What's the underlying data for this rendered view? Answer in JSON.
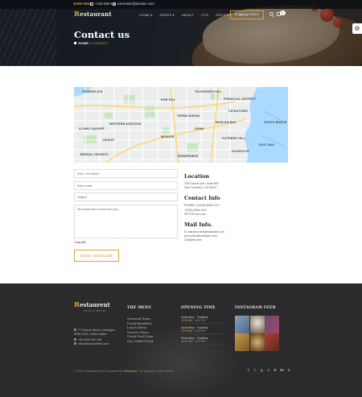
{
  "topbar": {
    "order_label": "Order Now!",
    "phone": "+123-205-445",
    "email": "username@domain.com"
  },
  "brand": {
    "name_initial": "R",
    "name_rest": "estaurant"
  },
  "nav": {
    "items": [
      {
        "label": "HOME",
        "caret": true
      },
      {
        "label": "PAGES",
        "caret": true
      },
      {
        "label": "ABOUT",
        "caret": false
      },
      {
        "label": "CTO",
        "caret": false
      },
      {
        "label": "RECIPES",
        "caret": false
      },
      {
        "label": "BLOG",
        "caret": false
      }
    ],
    "reserve_label": "BOOK A TABLE",
    "cart_count": "0"
  },
  "hero": {
    "title": "Contact us",
    "crumb_home": "HOME",
    "crumb_sep": "/",
    "crumb_current": "CONTACT"
  },
  "map": {
    "labels": [
      "TENDERLOIN",
      "TELEGRAPH HILL",
      "NOB HILL",
      "FINANCIAL DISTRICT",
      "CHINATOWN",
      "SOUTH BEACH",
      "YERBA BUENA",
      "POTRERO HILL",
      "MISSION BAY",
      "SOMA",
      "MISSION",
      "ALAMO SQUARE",
      "HAIGHT",
      "WESTERN ADDITION",
      "DOGPATCH",
      "BERNAL HEIGHTS",
      "TENDERNESS",
      "EAST BAY"
    ]
  },
  "form": {
    "name_placeholder": "Enter Your Name",
    "email_placeholder": "Enter email",
    "subject_placeholder": "Subject",
    "message_placeholder": "We would love to hear from you...",
    "captcha_label": "Cozy Mix",
    "send_label": "SEND MESSAGE"
  },
  "info": {
    "location_title": "Location",
    "location_lines": [
      "795 Folsom Ave, Suite 600",
      "San Francisco, CA 94107"
    ],
    "contact_title": "Contact Info",
    "contact_lines": [
      "PHONE:+(1234) 8546-XXX",
      "+(234) 8546-XXX",
      "SKYPE://un.cow"
    ],
    "mail_title": "Mail Info.",
    "mail_lines": [
      "E-mail:john.trek@example.com",
      "jhon.strek@example.com",
      "ToD@trit.dew"
    ]
  },
  "footer": {
    "logo_initial": "R",
    "logo_rest": "estaurent",
    "logo_sub": "FOOD & DRINK",
    "address_lines": [
      "77 Francis Street, Darlington",
      "NSW 2010, United States"
    ],
    "phone": "+00 0000 654 356",
    "email": "office@scboarbitoo.com",
    "menu_title": "THE MENU",
    "menu_items": [
      "Seasonal Items",
      "Fresh Breakfast",
      "Lunch Menu",
      "Dessert Menu",
      "Fresh Food Zone",
      "Our Grilled Food"
    ],
    "hours_title": "OPENING TIME",
    "hours": [
      {
        "day": "Saturday - Sunday",
        "time": "10:00 AM",
        "pm": "3:00 PM"
      },
      {
        "day": "Saturday - Sunday",
        "time": "10:00 AM",
        "pm": "3:00 PM"
      },
      {
        "day": "Saturday - Sunday",
        "time": "10:00 AM",
        "pm": "3:00 PM"
      }
    ],
    "insta_title": "INSTAGRAM FEED",
    "copyright_pre": "© 2017 Restaurant Zone is powered by",
    "copyright_hl": "Minnesota",
    "copyright_post": ". The property of their owners",
    "social_icons": [
      "f",
      "t",
      "g",
      "v",
      "B",
      "Be",
      "d"
    ],
    "social_names": [
      "facebook-icon",
      "twitter-icon",
      "instagram-icon",
      "vimeo-icon",
      "behance-icon",
      "dribbble-icon",
      "github-icon"
    ]
  },
  "colors": {
    "accent": "#d9a441",
    "footer_bg": "#2b2b2d",
    "hero_bg": "#1f252d"
  }
}
